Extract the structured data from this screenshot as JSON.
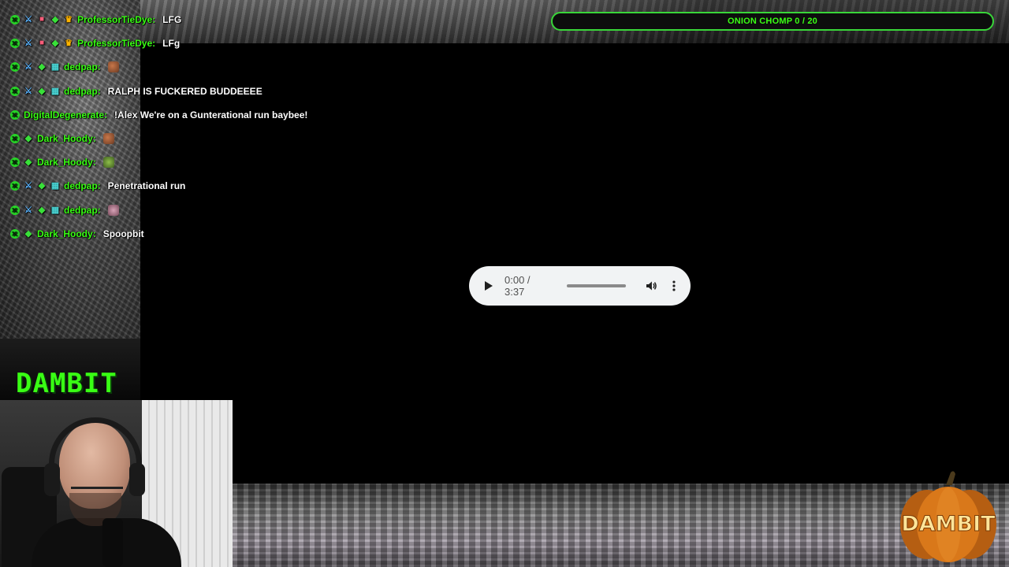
{
  "chat": {
    "messages": [
      {
        "badges": [
          "x",
          "sword",
          "gift",
          "gem",
          "crown"
        ],
        "user": "ProfessorTieDye:",
        "text": "LFG",
        "emote": ""
      },
      {
        "badges": [
          "x",
          "sword",
          "gift",
          "gem",
          "crown"
        ],
        "user": "ProfessorTieDye:",
        "text": "LFg",
        "emote": ""
      },
      {
        "badges": [
          "x",
          "sword",
          "gem",
          "grid"
        ],
        "user": "dedpap:",
        "text": "",
        "emote": "brown"
      },
      {
        "badges": [
          "x",
          "sword",
          "gem",
          "grid"
        ],
        "user": "dedpap:",
        "text": "RALPH IS FUCKERED BUDDEEEE",
        "emote": ""
      },
      {
        "badges": [
          "x"
        ],
        "user": "DigitalDegenerate:",
        "text": "!Alex We're on a Gunterational run baybee!",
        "emote": ""
      },
      {
        "badges": [
          "x",
          "gem"
        ],
        "user": "Dark_Hoody:",
        "text": "",
        "emote": "brown"
      },
      {
        "badges": [
          "x",
          "gem"
        ],
        "user": "Dark_Hoody:",
        "text": "",
        "emote": "green"
      },
      {
        "badges": [
          "x",
          "sword",
          "gem",
          "grid"
        ],
        "user": "dedpap:",
        "text": "Penetrational run",
        "emote": ""
      },
      {
        "badges": [
          "x",
          "sword",
          "gem",
          "grid"
        ],
        "user": "dedpap:",
        "text": "",
        "emote": "pink"
      },
      {
        "badges": [
          "x",
          "gem"
        ],
        "user": "Dark_Hoody:",
        "text": "Spoopbit",
        "emote": ""
      }
    ]
  },
  "goal": {
    "label": "ONION CHOMP 0 / 20",
    "progress": 0
  },
  "audio": {
    "time": "0:00 / 3:37",
    "progress": 0
  },
  "brand": {
    "logo_text": "DAMBIT",
    "pumpkin_text": "DAMBIT"
  },
  "colors": {
    "accent_green": "#39ff14",
    "username_green": "#39ff14",
    "pumpkin_orange": "#d9781a"
  }
}
